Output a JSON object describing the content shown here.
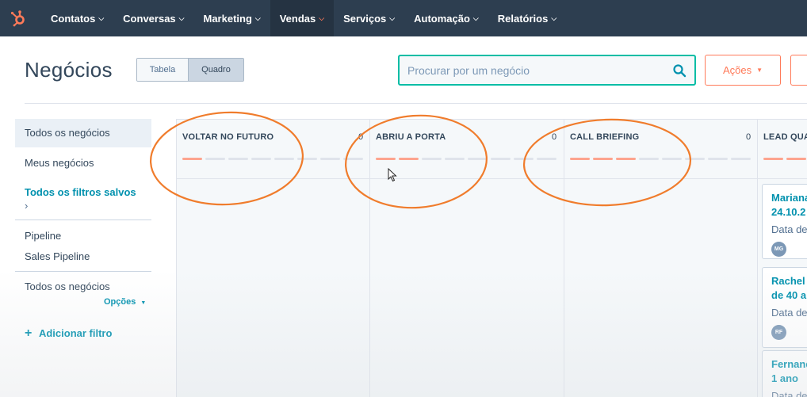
{
  "nav": {
    "items": [
      {
        "label": "Contatos",
        "active": false
      },
      {
        "label": "Conversas",
        "active": false
      },
      {
        "label": "Marketing",
        "active": false
      },
      {
        "label": "Vendas",
        "active": true
      },
      {
        "label": "Serviços",
        "active": false
      },
      {
        "label": "Automação",
        "active": false
      },
      {
        "label": "Relatórios",
        "active": false
      }
    ],
    "logo_icon": "hubspot-sprocket-icon",
    "chevron_icon": "chevron-down-icon"
  },
  "header": {
    "title": "Negócios",
    "views": {
      "table": "Tabela",
      "board": "Quadro",
      "selected": "Quadro"
    },
    "search_placeholder": "Procurar por um negócio",
    "actions_label": "Ações"
  },
  "sidebar": {
    "all_deals": "Todos os negócios",
    "my_deals": "Meus negócios",
    "saved_filters": "Todos os filtros salvos",
    "pipeline_label": "Pipeline",
    "pipeline_value": "Sales Pipeline",
    "all_deals_filter": "Todos os negócios",
    "options_label": "Opções",
    "add_filter": "Adicionar filtro"
  },
  "board": {
    "columns": [
      {
        "title": "VOLTAR NO FUTURO",
        "count": "0",
        "progress_segments_on": 1
      },
      {
        "title": "ABRIU A PORTA",
        "count": "0",
        "progress_segments_on": 2
      },
      {
        "title": "CALL BRIEFING",
        "count": "0",
        "progress_segments_on": 3
      },
      {
        "title": "LEAD QUA",
        "count": "",
        "progress_segments_on": 4
      }
    ],
    "cards": [
      {
        "title_line1": "Mariana",
        "title_line2": "24.10.2",
        "meta": "Data de",
        "avatar": "MG"
      },
      {
        "title_line1": "Rachel",
        "title_line2": "de 40 a",
        "meta": "Data de",
        "avatar": "RF"
      },
      {
        "title_line1": "Fernand",
        "title_line2": "1 ano",
        "meta": "Data de",
        "avatar": ""
      }
    ]
  },
  "colors": {
    "nav_bg": "#2d3e50",
    "accent_orange": "#ff7a59",
    "teal_link": "#0091ae",
    "annotation_orange": "#f07c2c"
  }
}
